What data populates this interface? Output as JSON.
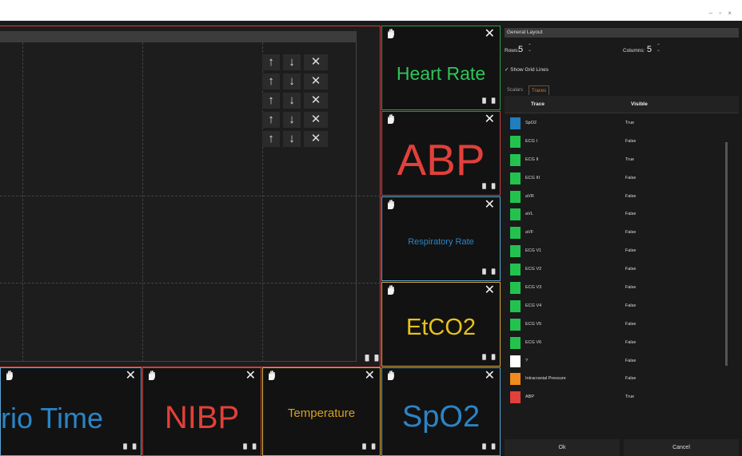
{
  "window": {
    "controls": "– ▫ ×"
  },
  "arrows": {
    "up": "↑",
    "down": "↓",
    "close": "✕",
    "rows": 5
  },
  "tiles": [
    {
      "id": "heart-rate",
      "label": "Heart Rate",
      "color": "#2ec65a",
      "border": "#2f9a4c"
    },
    {
      "id": "abp",
      "label": "ABP",
      "color": "#e2403a",
      "border": "#c9413f"
    },
    {
      "id": "resp",
      "label": "Respiratory Rate",
      "color": "#2b84c6",
      "border": "#5aa6d4"
    },
    {
      "id": "etco2",
      "label": "EtCO2",
      "color": "#e8c21c",
      "border": "#d8a93a"
    },
    {
      "id": "scenario",
      "label": "rio Time",
      "color": "#2b84c6",
      "border": "#5aa6d4"
    },
    {
      "id": "nibp",
      "label": "NIBP",
      "color": "#e2403a",
      "border": "#c9413f"
    },
    {
      "id": "temp",
      "label": "Temperature",
      "color": "#d6a21e",
      "border": "#d8a93a"
    },
    {
      "id": "spo2",
      "label": "SpO2",
      "color": "#2b84c6",
      "border": "#5aa6d4"
    }
  ],
  "side": {
    "title": "General Layout",
    "rows_label": "Rows:",
    "rows_value": "5",
    "columns_label": "Columns:",
    "columns_value": "5",
    "show_grid": "Show Grid Lines",
    "tabs": [
      "Scalars",
      "Traces"
    ],
    "col_trace": "Trace",
    "col_visible": "Visible",
    "traces": [
      {
        "name": "SpO2",
        "visible": "True",
        "color": "#1f7fbf"
      },
      {
        "name": "ECG I",
        "visible": "False",
        "color": "#22c24f"
      },
      {
        "name": "ECG II",
        "visible": "True",
        "color": "#22c24f"
      },
      {
        "name": "ECG III",
        "visible": "False",
        "color": "#22c24f"
      },
      {
        "name": "aVR",
        "visible": "False",
        "color": "#22c24f"
      },
      {
        "name": "aVL",
        "visible": "False",
        "color": "#22c24f"
      },
      {
        "name": "aVF",
        "visible": "False",
        "color": "#22c24f"
      },
      {
        "name": "ECG V1",
        "visible": "False",
        "color": "#22c24f"
      },
      {
        "name": "ECG V2",
        "visible": "False",
        "color": "#22c24f"
      },
      {
        "name": "ECG V3",
        "visible": "False",
        "color": "#22c24f"
      },
      {
        "name": "ECG V4",
        "visible": "False",
        "color": "#22c24f"
      },
      {
        "name": "ECG V5",
        "visible": "False",
        "color": "#22c24f"
      },
      {
        "name": "ECG V6",
        "visible": "False",
        "color": "#22c24f"
      },
      {
        "name": "?",
        "visible": "False",
        "color": "#ffffff"
      },
      {
        "name": "Intracranial Pressure",
        "visible": "False",
        "color": "#f08a1c"
      },
      {
        "name": "ABP",
        "visible": "True",
        "color": "#e2403a"
      }
    ],
    "ok": "Ok",
    "cancel": "Cancel"
  }
}
